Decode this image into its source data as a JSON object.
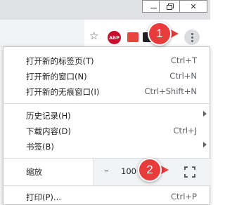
{
  "window_controls": {
    "minimize": "—",
    "maximize": "⧉",
    "close": "✕"
  },
  "toolbar": {
    "abp_label": "ABP"
  },
  "menu": {
    "group1": [
      {
        "label": "打开新的标签页(T)",
        "shortcut": "Ctrl+T"
      },
      {
        "label": "打开新的窗口(N)",
        "shortcut": "Ctrl+N"
      },
      {
        "label": "打开新的无痕窗口(I)",
        "shortcut": "Ctrl+Shift+N"
      }
    ],
    "group2": [
      {
        "label": "历史记录(H)",
        "shortcut": ""
      },
      {
        "label": "下载内容(D)",
        "shortcut": "Ctrl+J"
      },
      {
        "label": "书签(B)",
        "shortcut": ""
      }
    ],
    "zoom": {
      "label": "缩放",
      "minus": "–",
      "value": "100"
    },
    "print": {
      "label": "打印(P)...",
      "shortcut": "Ctrl+P"
    }
  },
  "annotations": {
    "badge1": "1",
    "badge2": "2"
  },
  "colors": {
    "badge": "#e83b3b",
    "abp": "#c70d2c",
    "menu_bg": "#ffffff",
    "zoom_bg": "#f1f3f4"
  },
  "icons": [
    "minimize-icon",
    "maximize-icon",
    "close-icon",
    "bookmark-star-icon",
    "adblock-plus-icon",
    "extension-icon",
    "extension-dark-icon",
    "more-menu-icon",
    "submenu-arrow-icon",
    "fullscreen-icon"
  ]
}
